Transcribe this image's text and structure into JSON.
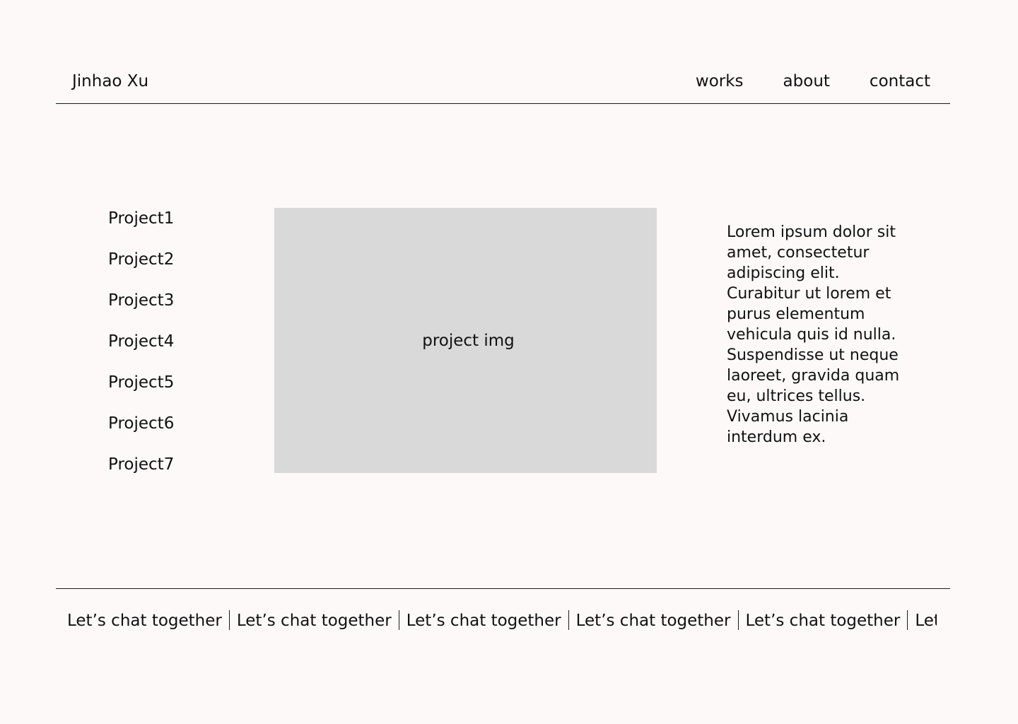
{
  "header": {
    "brand": "Jinhao Xu",
    "nav": [
      "works",
      "about",
      "contact"
    ]
  },
  "main": {
    "projects": [
      "Project1",
      "Project2",
      "Project3",
      "Project4",
      "Project5",
      "Project6",
      "Project7"
    ],
    "image_label": "project img",
    "description": "Lorem ipsum dolor sit amet, consectetur adipiscing elit. Curabitur ut lorem et purus elementum vehicula quis id nulla. Suspendisse ut neque laoreet, gravida quam eu, ultrices tellus. Vivamus lacinia interdum ex."
  },
  "footer": {
    "marquee": [
      "Let’s chat together",
      "Let’s chat together",
      "Let’s chat together",
      "Let’s chat together",
      "Let’s chat together",
      "Let’s chat together"
    ]
  },
  "colors": {
    "background": "#fdf9f9",
    "text": "#111111",
    "image_placeholder": "#d9d9d9",
    "rule": "#1a1a1a"
  }
}
